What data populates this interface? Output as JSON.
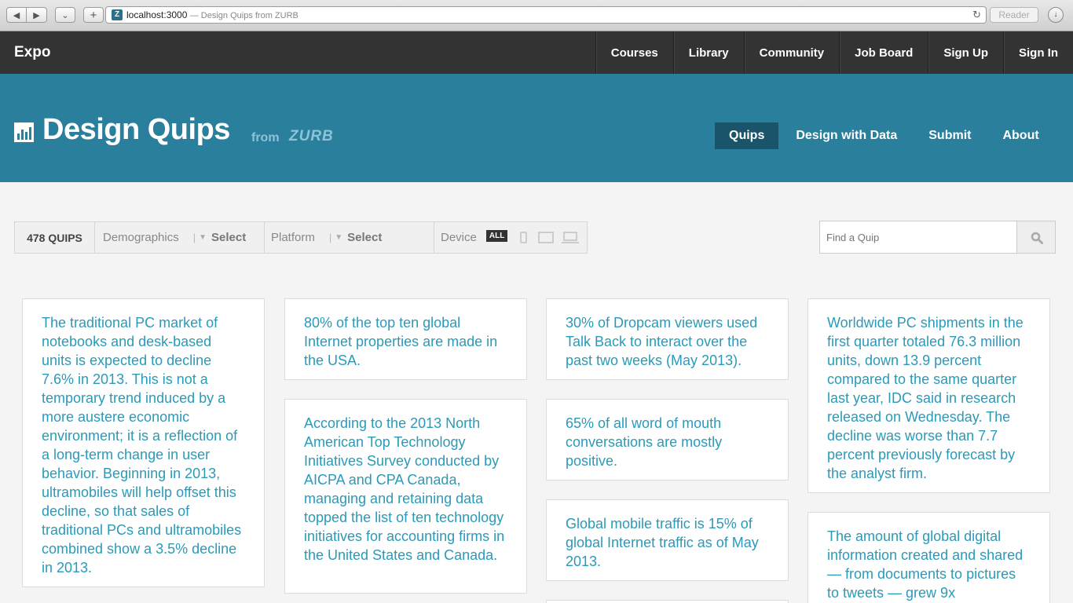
{
  "browser": {
    "url": "localhost:3000",
    "title_suffix": "— Design Quips from ZURB",
    "reader_label": "Reader"
  },
  "topnav": {
    "brand": "Expo",
    "items": [
      "Courses",
      "Library",
      "Community",
      "Job Board",
      "Sign Up",
      "Sign In"
    ]
  },
  "hero": {
    "title": "Design Quips",
    "from": "from",
    "brand": "ZURB",
    "nav": [
      {
        "label": "Quips",
        "active": true
      },
      {
        "label": "Design with Data",
        "active": false
      },
      {
        "label": "Submit",
        "active": false
      },
      {
        "label": "About",
        "active": false
      }
    ]
  },
  "filters": {
    "count": "478 QUIPS",
    "demographics_label": "Demographics",
    "demographics_value": "Select",
    "platform_label": "Platform",
    "platform_value": "Select",
    "device_label": "Device",
    "device_all": "ALL"
  },
  "search": {
    "placeholder": "Find a Quip"
  },
  "quips": [
    "The traditional PC market of notebooks and desk-based units is expected to decline 7.6% in 2013. This is not a temporary trend induced by a more austere economic environment; it is a reflection of a long-term change in user behavior. Beginning in 2013, ultramobiles will help offset this decline, so that sales of traditional PCs and ultramobiles combined show a 3.5% decline in 2013.",
    "80% of the top ten global Internet properties are made in the USA.",
    "According to the 2013 North American Top Technology Initiatives Survey conducted by AICPA and CPA Canada, managing and retaining data topped the list of ten technology initiatives for accounting firms in the United States and Canada.",
    "30% of Dropcam viewers used Talk Back to interact over the past two weeks (May 2013).",
    "65% of all word of mouth conversations are mostly positive.",
    "Global mobile traffic is 15% of global Internet traffic as of May 2013.",
    "Worldwide PC shipments in the first quarter totaled 76.3 million units, down 13.9 percent compared to the same quarter last year, IDC said in research released on Wednesday. The decline was worse than 7.7 percent previously forecast by the analyst firm.",
    "The amount of global digital information created and shared — from documents to pictures to tweets — grew 9x"
  ]
}
